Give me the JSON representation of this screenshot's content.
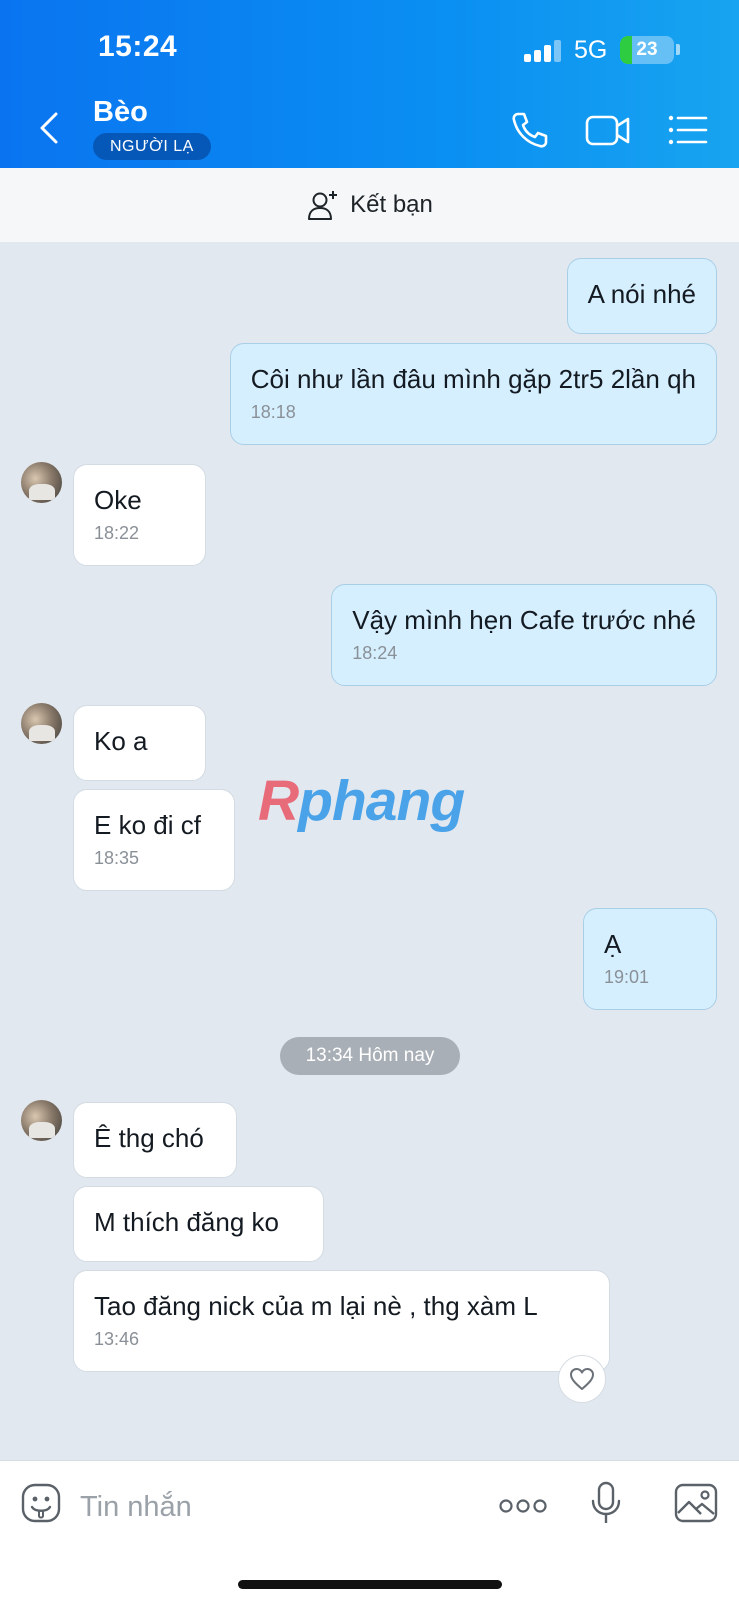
{
  "status_bar": {
    "time": "15:24",
    "network": "5G",
    "battery": "23",
    "battery_level_percent": 23
  },
  "header": {
    "name": "Bèo",
    "badge": "NGƯỜI LẠ"
  },
  "add_friend": {
    "label": "Kết bạn"
  },
  "messages": [
    {
      "side": "out",
      "text": "A nói nhé"
    },
    {
      "side": "out",
      "text": "Côi như lần đâu mình gặp 2tr5 2lần qh",
      "time": "18:18"
    },
    {
      "side": "in",
      "text": "Oke",
      "time": "18:22"
    },
    {
      "side": "out",
      "text": "Vậy mình hẹn Cafe trước nhé",
      "time": "18:24"
    },
    {
      "side": "in",
      "text": "Ko a"
    },
    {
      "side": "in",
      "text": "E ko đi cf",
      "time": "18:35"
    },
    {
      "side": "out",
      "text": "Ạ",
      "time": "19:01"
    },
    {
      "side": "in",
      "text": "Ê thg chó"
    },
    {
      "side": "in",
      "text": "M thích đăng ko"
    },
    {
      "side": "in",
      "text": "Tao đăng nick của m lại nè , thg xàm L",
      "time": "13:46"
    }
  ],
  "date_separator": "13:34 Hôm nay",
  "watermark": {
    "first": "R",
    "rest": "phang"
  },
  "input": {
    "placeholder": "Tin nhắn"
  },
  "colors": {
    "header": "#0a8ff2",
    "outgoing_bubble": "#d5efff",
    "incoming_bubble": "#ffffff",
    "background": "#e2e8f0"
  },
  "icons": [
    "back-icon",
    "phone-icon",
    "video-call-icon",
    "menu-list-icon",
    "add-friend-icon",
    "heart-icon",
    "emoji-icon",
    "more-icon",
    "microphone-icon",
    "image-icon"
  ]
}
